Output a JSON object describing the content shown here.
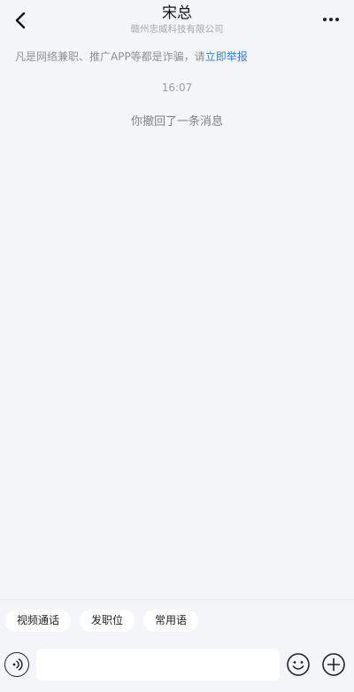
{
  "header": {
    "title": "宋总",
    "subtitle": "赣州忠威科技有限公司",
    "back_icon": "chevron-left-icon",
    "more_icon": "more-dots-icon"
  },
  "notice": {
    "text": "凡是网络兼职、推广APP等都是诈骗，请",
    "link_text": "立即举报",
    "link_color": "#3b7bdb"
  },
  "messages": {
    "time": "16:07",
    "recall_text": "你撤回了一条消息"
  },
  "quick_actions": [
    "视频通话",
    "发职位",
    "常用语"
  ],
  "composer": {
    "input_value": "",
    "voice_icon": "voice-icon",
    "emoji_icon": "emoji-icon",
    "plus_icon": "plus-icon"
  }
}
